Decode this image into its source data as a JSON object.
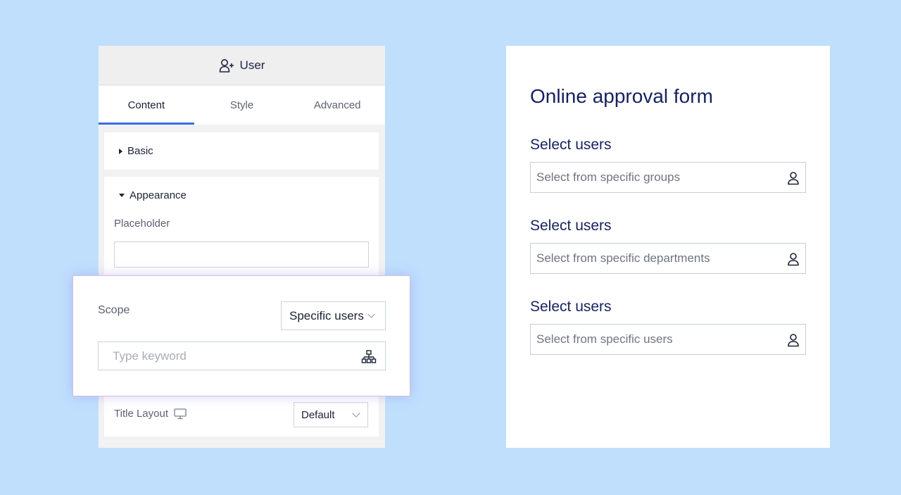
{
  "editor": {
    "header_title": "User",
    "tabs": [
      {
        "label": "Content",
        "active": true
      },
      {
        "label": "Style",
        "active": false
      },
      {
        "label": "Advanced",
        "active": false
      }
    ],
    "sections": {
      "basic": "Basic",
      "appearance": "Appearance"
    },
    "placeholder_label": "Placeholder",
    "placeholder_value": "",
    "title_layout_label": "Title Layout",
    "title_layout_value": "Default"
  },
  "scope": {
    "label": "Scope",
    "selected": "Specific users",
    "keyword_placeholder": "Type keyword"
  },
  "form": {
    "title": "Online approval form",
    "fields": [
      {
        "label": "Select users",
        "placeholder": "Select from specific groups"
      },
      {
        "label": "Select users",
        "placeholder": "Select from specific departments"
      },
      {
        "label": "Select users",
        "placeholder": "Select from specific users"
      }
    ]
  },
  "colors": {
    "background": "#bfdffd",
    "accent": "#3b6be8",
    "form_text": "#16225e"
  }
}
